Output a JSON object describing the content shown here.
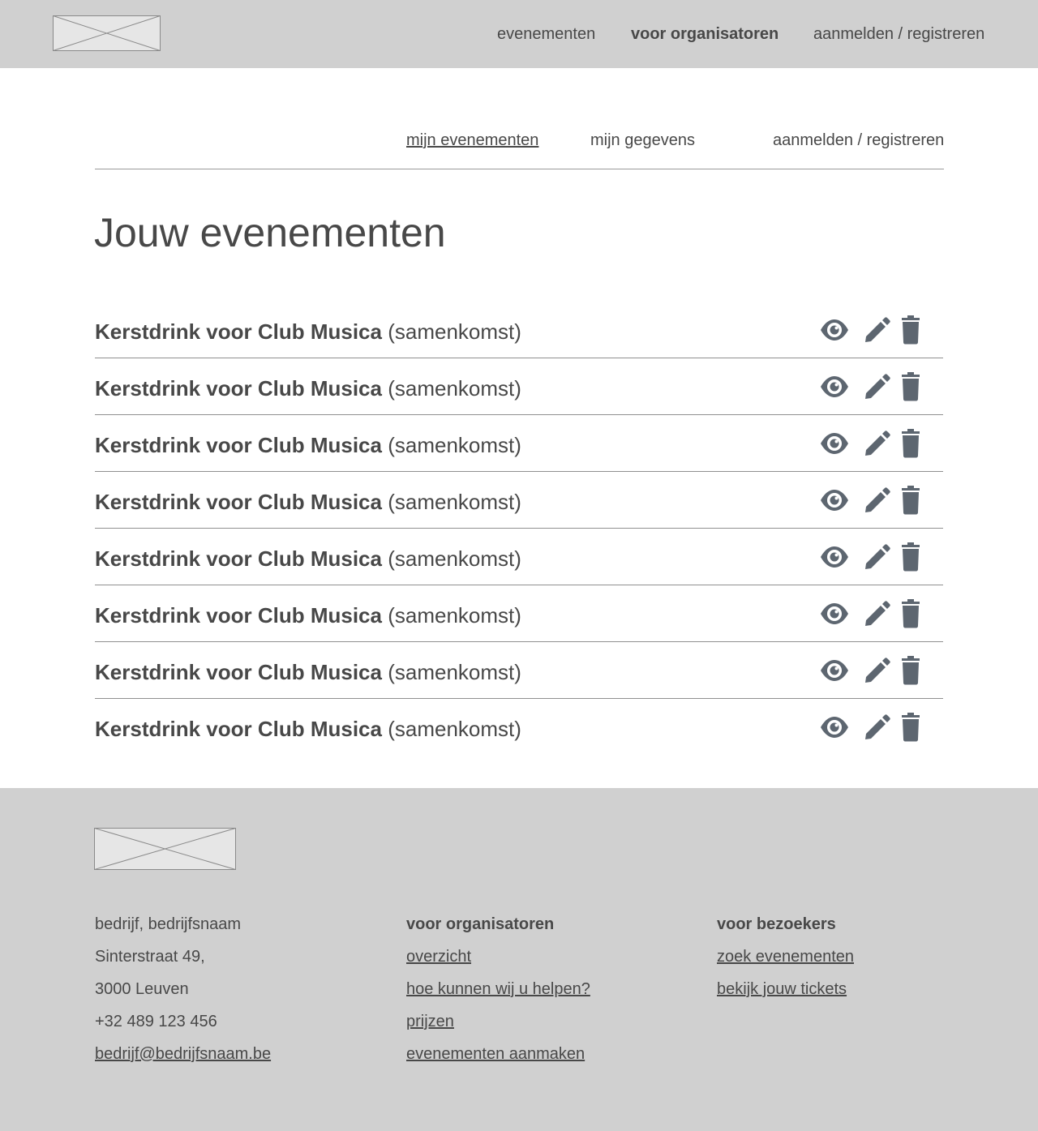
{
  "header": {
    "logo_alt": "",
    "nav": [
      {
        "label": "evenementen"
      },
      {
        "label": "voor organisatoren"
      },
      {
        "label": "aanmelden / registreren"
      }
    ]
  },
  "subnav": {
    "items": [
      {
        "label": "mijn evenementen"
      },
      {
        "label": "mijn gegevens"
      },
      {
        "label": "aanmelden / registreren"
      }
    ]
  },
  "main": {
    "title": "Jouw evenementen",
    "events": [
      {
        "name": "Kerstdrink voor Club Musica",
        "type": "(samenkomst)"
      },
      {
        "name": "Kerstdrink voor Club Musica",
        "type": "(samenkomst)"
      },
      {
        "name": "Kerstdrink voor Club Musica",
        "type": "(samenkomst)"
      },
      {
        "name": "Kerstdrink voor Club Musica",
        "type": "(samenkomst)"
      },
      {
        "name": "Kerstdrink voor Club Musica",
        "type": "(samenkomst)"
      },
      {
        "name": "Kerstdrink voor Club Musica",
        "type": "(samenkomst)"
      },
      {
        "name": "Kerstdrink voor Club Musica",
        "type": "(samenkomst)"
      },
      {
        "name": "Kerstdrink voor Club Musica",
        "type": "(samenkomst)"
      }
    ],
    "row_icons": [
      "eye-icon",
      "pencil-icon",
      "trash-icon"
    ]
  },
  "footer": {
    "company": {
      "lines": [
        "bedrijf, bedrijfsnaam",
        "Sinterstraat 49,",
        "3000 Leuven",
        "+32 489 123 456"
      ],
      "email": "bedrijf@bedrijfsnaam.be"
    },
    "organizers": {
      "heading": "voor organisatoren",
      "links": [
        "overzicht",
        "hoe kunnen wij u helpen?",
        "prijzen",
        "evenementen aanmaken"
      ]
    },
    "visitors": {
      "heading": "voor bezoekers",
      "links": [
        "zoek evenementen",
        "bekijk jouw tickets"
      ]
    }
  },
  "colors": {
    "header_bg": "#d0d0d0",
    "footer_bg": "#d0d0d0",
    "text": "#484848",
    "icon": "#5d6670",
    "divider": "#8f8f8f"
  }
}
